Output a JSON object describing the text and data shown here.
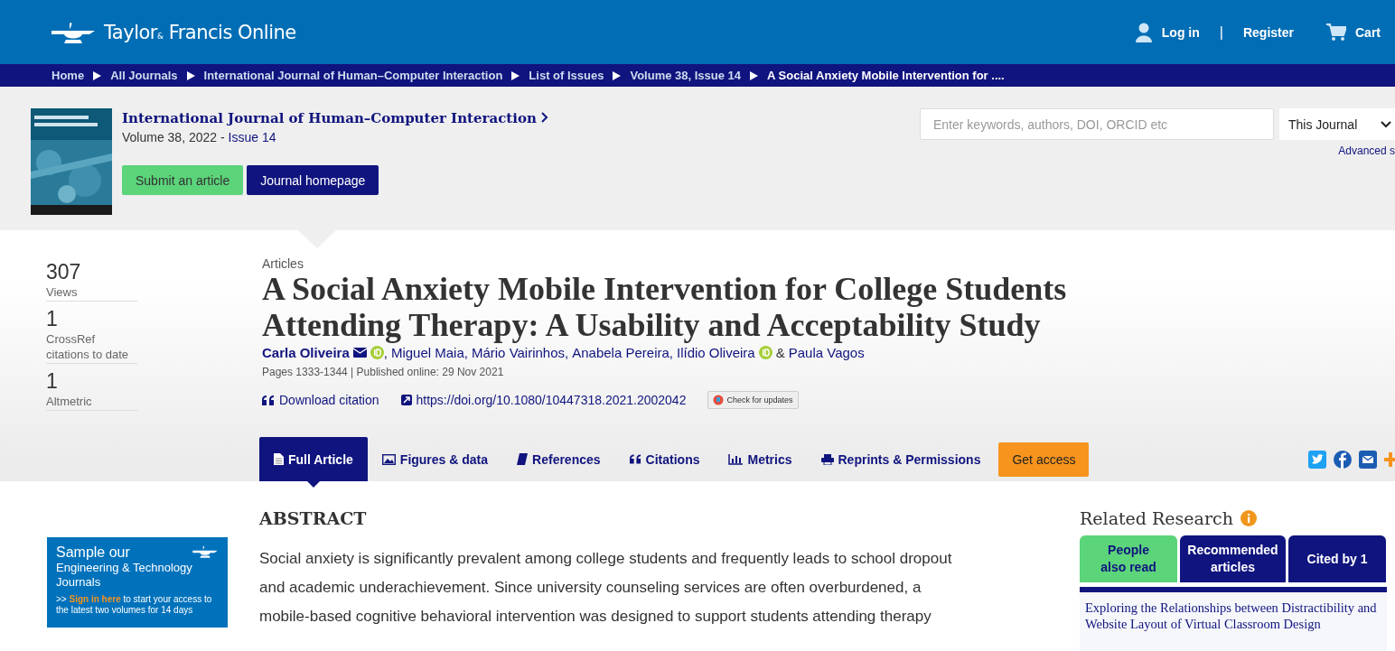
{
  "header": {
    "logo": [
      "Taylor",
      "&",
      "Francis Online"
    ],
    "login": "Log in",
    "divider": "|",
    "register": "Register",
    "cart": "Cart"
  },
  "breadcrumbs": [
    {
      "label": "Home",
      "current": false
    },
    {
      "label": "All Journals",
      "current": false
    },
    {
      "label": "International Journal of Human–Computer Interaction",
      "current": false
    },
    {
      "label": "List of Issues",
      "current": false
    },
    {
      "label": "Volume 38, Issue 14",
      "current": false
    },
    {
      "label": "A Social Anxiety Mobile Intervention for ....",
      "current": true
    }
  ],
  "journal": {
    "title": "International Journal of Human–Computer Interaction",
    "volume": "Volume 38, 2022 -",
    "issue": "Issue 14",
    "buttons": [
      {
        "label": "Submit an article",
        "kind": "submit"
      },
      {
        "label": "Journal homepage",
        "kind": "homepage"
      }
    ]
  },
  "search": {
    "placeholder": "Enter keywords, authors, DOI, ORCID etc",
    "scope": "This Journal",
    "advanced": "Advanced s"
  },
  "metrics": [
    {
      "value": "307",
      "label": "Views"
    },
    {
      "value": "1",
      "label": "CrossRef citations to date"
    },
    {
      "value": "1",
      "label": "Altmetric"
    }
  ],
  "article": {
    "type": "Articles",
    "title": "A Social Anxiety Mobile Intervention for College Students Attending Therapy: A Usability and Acceptability Study",
    "authors": [
      {
        "kind": "author",
        "text": "Carla Oliveira",
        "lead": true,
        "email": true,
        "orcid": true
      },
      {
        "kind": "sep",
        "text": ","
      },
      {
        "kind": "author",
        "text": "Miguel Maia",
        "lead": false,
        "email": false,
        "orcid": false
      },
      {
        "kind": "sep",
        "text": ","
      },
      {
        "kind": "author",
        "text": "Mário Vairinhos",
        "lead": false,
        "email": false,
        "orcid": false
      },
      {
        "kind": "sep",
        "text": ","
      },
      {
        "kind": "author",
        "text": "Anabela Pereira",
        "lead": false,
        "email": false,
        "orcid": false
      },
      {
        "kind": "sep",
        "text": ","
      },
      {
        "kind": "author",
        "text": "Ilídio Oliveira",
        "lead": false,
        "email": false,
        "orcid": true
      },
      {
        "kind": "sep",
        "text": "&"
      },
      {
        "kind": "author",
        "text": "Paula Vagos",
        "lead": false,
        "email": false,
        "orcid": false
      }
    ],
    "pages": "Pages 1333-1344 | Published online: 29 Nov 2021",
    "citation": "Download citation",
    "doi": "https://doi.org/10.1080/10447318.2021.2002042",
    "updates": "Check for updates"
  },
  "tabs": [
    {
      "label": "Full Article",
      "selected": true
    },
    {
      "label": "Figures & data",
      "selected": false
    },
    {
      "label": "References",
      "selected": false
    },
    {
      "label": "Citations",
      "selected": false
    },
    {
      "label": "Metrics",
      "selected": false
    },
    {
      "label": "Reprints & Permissions",
      "selected": false
    }
  ],
  "access": "Get access",
  "promo": {
    "title": "Sample our",
    "subtitle": "Engineering & Technology Journals",
    "arrows": ">>",
    "link": "Sign in here",
    "text": "to start your access to the latest two volumes for 14 days"
  },
  "abstract": {
    "heading": "ABSTRACT",
    "lines": [
      "Social anxiety is significantly prevalent among college students and frequently leads to school dropout",
      "and academic underachievement. Since university counseling services are often overburdened, a",
      "mobile-based cognitive behavioral intervention was designed to support students attending therapy"
    ]
  },
  "related": {
    "heading": "Related Research",
    "tabs": [
      {
        "label": "People also read",
        "selected": true
      },
      {
        "label": "Recommended articles",
        "selected": false
      },
      {
        "label": "Cited by 1",
        "selected": false
      }
    ],
    "item": "Exploring the Relationships between Distractibility and Website Layout of Virtual Classroom Design"
  }
}
